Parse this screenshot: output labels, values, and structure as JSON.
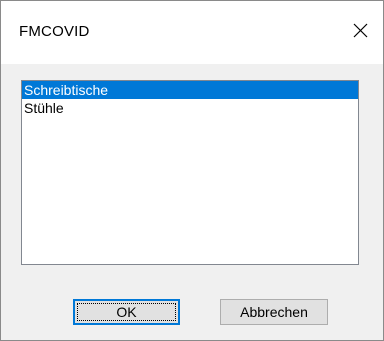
{
  "window": {
    "title": "FMCOVID"
  },
  "list": {
    "items": [
      {
        "label": "Schreibtische",
        "selected": true
      },
      {
        "label": "Stühle",
        "selected": false
      }
    ]
  },
  "buttons": {
    "ok_label": "OK",
    "cancel_label": "Abbrechen"
  },
  "colors": {
    "selection": "#0078d7",
    "dialog_background": "#f0f0f0",
    "titlebar_background": "#ffffff"
  }
}
